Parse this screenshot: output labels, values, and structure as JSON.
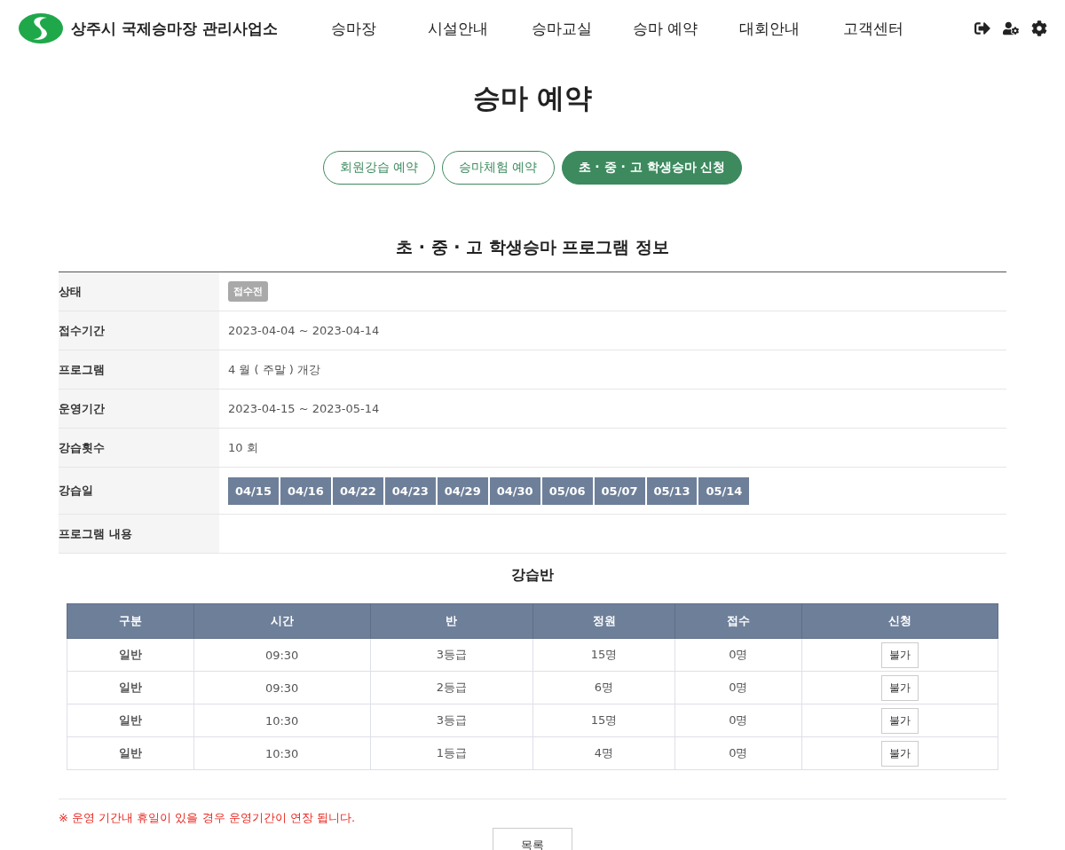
{
  "header": {
    "site_name": "상주시 국제승마장 관리사업소",
    "nav": [
      {
        "label": "승마장"
      },
      {
        "label": "시설안내"
      },
      {
        "label": "승마교실"
      },
      {
        "label": "승마 예약"
      },
      {
        "label": "대회안내"
      },
      {
        "label": "고객센터"
      }
    ]
  },
  "page_title": "승마 예약",
  "tabs": [
    {
      "label": "회원강습 예약",
      "selected": false
    },
    {
      "label": "승마체험 예약",
      "selected": false
    },
    {
      "label": "초 · 중 · 고 학생승마 신청",
      "selected": true
    }
  ],
  "section_title": "초 · 중 · 고 학생승마 프로그램 정보",
  "info_rows": [
    {
      "kind": "badge",
      "label": "상태",
      "value": "접수전"
    },
    {
      "kind": "text",
      "label": "접수기간",
      "value": "2023-04-04 ~ 2023-04-14"
    },
    {
      "kind": "text",
      "label": "프로그램",
      "value": "4 월 ( 주말 ) 개강"
    },
    {
      "kind": "text",
      "label": "운영기간",
      "value": "2023-04-15 ~ 2023-05-14"
    },
    {
      "kind": "text",
      "label": "강습횟수",
      "value": "10 회"
    },
    {
      "kind": "dates",
      "label": "강습일",
      "dates": [
        "04/15",
        "04/16",
        "04/22",
        "04/23",
        "04/29",
        "04/30",
        "05/06",
        "05/07",
        "05/13",
        "05/14"
      ]
    },
    {
      "kind": "empty",
      "label": "프로그램 내용"
    }
  ],
  "class_table": {
    "title": "강습반",
    "columns": [
      "구분",
      "시간",
      "반",
      "정원",
      "접수",
      "신청"
    ],
    "rows": [
      {
        "type": "일반",
        "time": "09:30",
        "class": "3등급",
        "capacity": "15명",
        "applied": "0명",
        "action": "불가"
      },
      {
        "type": "일반",
        "time": "09:30",
        "class": "2등급",
        "capacity": "6명",
        "applied": "0명",
        "action": "불가"
      },
      {
        "type": "일반",
        "time": "10:30",
        "class": "3등급",
        "capacity": "15명",
        "applied": "0명",
        "action": "불가"
      },
      {
        "type": "일반",
        "time": "10:30",
        "class": "1등급",
        "capacity": "4명",
        "applied": "0명",
        "action": "불가"
      }
    ]
  },
  "notice": "※ 운영 기간내 휴일이 있을 경우 운영기간이 연장 됩니다.",
  "list_button": "목록"
}
